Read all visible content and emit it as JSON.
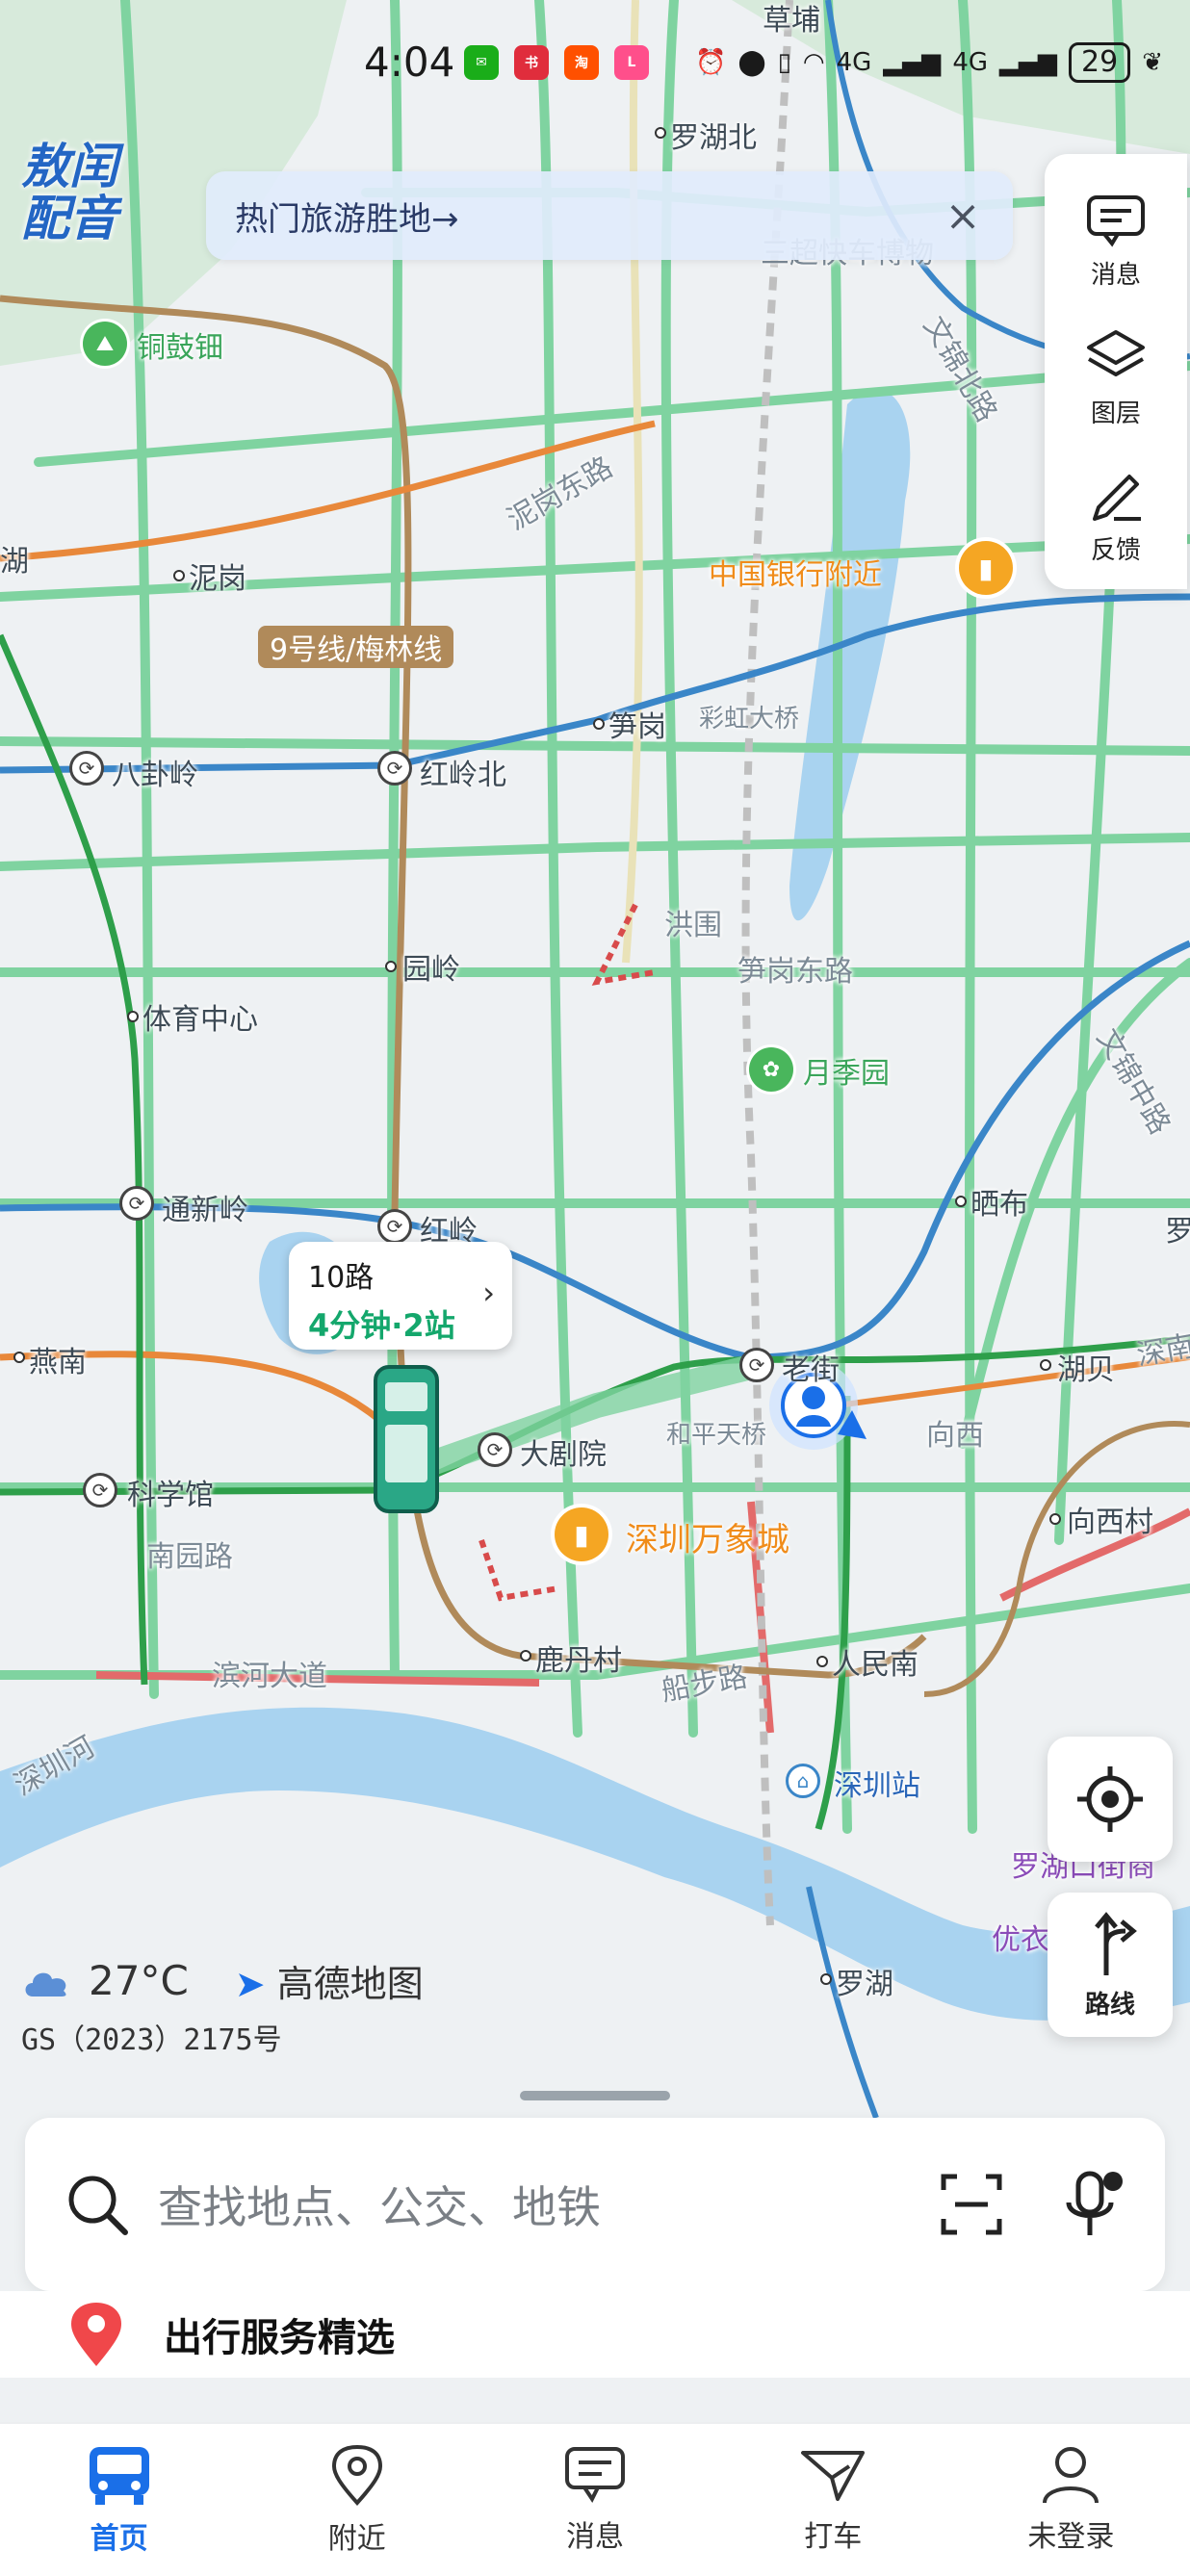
{
  "status_bar": {
    "time": "4:04",
    "apps": [
      "WeChat",
      "小红书",
      "淘",
      "Lulu"
    ],
    "network_1": "4G",
    "network_2": "4G",
    "battery": "29"
  },
  "watermark": "敖闰配音",
  "banner": {
    "text": "热门旅游胜地→",
    "close_icon": "×"
  },
  "side_panel": {
    "items": [
      {
        "label": "消息",
        "icon": "message-icon"
      },
      {
        "label": "图层",
        "icon": "layers-icon"
      },
      {
        "label": "反馈",
        "icon": "feedback-icon"
      }
    ]
  },
  "map": {
    "labels": {
      "caopu": "草埔",
      "luohu_bei": "罗湖北",
      "tonggu": "铜鼓钿",
      "nigang_dong": "泥岗东路",
      "wenjin_bei": "文锦北路",
      "hu": "湖",
      "nigang": "泥岗",
      "bank": "中国银行附近",
      "line9": "9号线/梅林线",
      "bagualing": "八卦岭",
      "honglingbei": "红岭北",
      "sungang": "笋岗",
      "caihong": "彩虹大桥",
      "hongwei": "洪围",
      "yuanling": "园岭",
      "sungang_dong": "笋岗东路",
      "tiyu": "体育中心",
      "yuejiyuan": "月季园",
      "wenjin_zhong": "文锦中路",
      "tongxinling": "通新岭",
      "hongling": "红岭",
      "shaibu": "晒布",
      "luo": "罗",
      "yannan": "燕南",
      "laojie": "老街",
      "hubei": "湖贝",
      "shenna": "深南",
      "dajuyuan": "大剧院",
      "hepingtian": "和平天桥",
      "xiangxi": "向西",
      "kexueguan": "科学馆",
      "xiangxicun": "向西村",
      "nanyuan": "南园路",
      "wanxiang": "深圳万象城",
      "binhe": "滨河大道",
      "ludancun": "鹿丹村",
      "chuanbu": "船步路",
      "renminnan": "人民南",
      "shenzhenhe": "深圳河",
      "shenzhenzhan": "深圳站",
      "luohujie": "罗湖口街商",
      "youke": "优衣",
      "luohu": "罗湖",
      "sanjin": "三超快车博物"
    }
  },
  "bus_card": {
    "line": "10路",
    "eta": "4分钟·2站"
  },
  "weather": {
    "temp": "27°C",
    "brand": "高德地图"
  },
  "license": "GS（2023）2175号",
  "locate_button": {
    "icon": "locate-icon"
  },
  "route_button": {
    "label": "路线"
  },
  "search": {
    "placeholder": "查找地点、公交、地铁"
  },
  "service": {
    "label": "出行服务精选"
  },
  "tabs": [
    {
      "label": "首页",
      "active": true
    },
    {
      "label": "附近",
      "active": false
    },
    {
      "label": "消息",
      "active": false
    },
    {
      "label": "打车",
      "active": false
    },
    {
      "label": "未登录",
      "active": false
    }
  ],
  "colors": {
    "road_green": "#7fd3a0",
    "metro_blue": "#3a86c8",
    "metro_brown": "#b08a5a",
    "metro_orange": "#e8883a",
    "metro_green": "#2e9f4a",
    "water": "#a9d3f0",
    "accent": "#1a6fe8"
  }
}
